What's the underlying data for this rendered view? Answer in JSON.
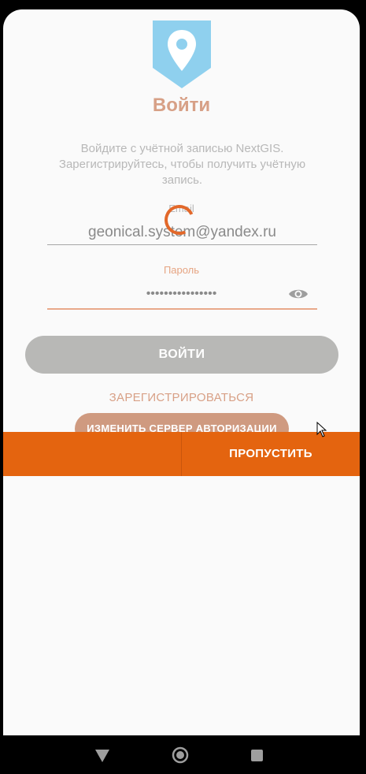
{
  "login": {
    "title": "Войти",
    "description": "Войдите с учётной записью NextGIS. Зарегистрируйтесь, чтобы получить учётную запись.",
    "email_label": "Email",
    "email_value": "geonical.system@yandex.ru",
    "password_label": "Пароль",
    "password_value": "••••••••••••••••",
    "login_button": "ВОЙТИ",
    "register_link": "ЗАРЕГИСТРИРОВАТЬСЯ",
    "change_server_button": "ИЗМЕНИТЬ СЕРВЕР АВТОРИЗАЦИИ"
  },
  "bottom_bar": {
    "skip_button": "ПРОПУСТИТЬ"
  },
  "colors": {
    "accent": "#e4640f",
    "title": "#d7a086",
    "logo": "#8fd0ee"
  },
  "icons": [
    "map-pin-logo-icon",
    "eye-icon",
    "back-icon",
    "home-icon",
    "recents-icon",
    "mouse-cursor-icon"
  ]
}
